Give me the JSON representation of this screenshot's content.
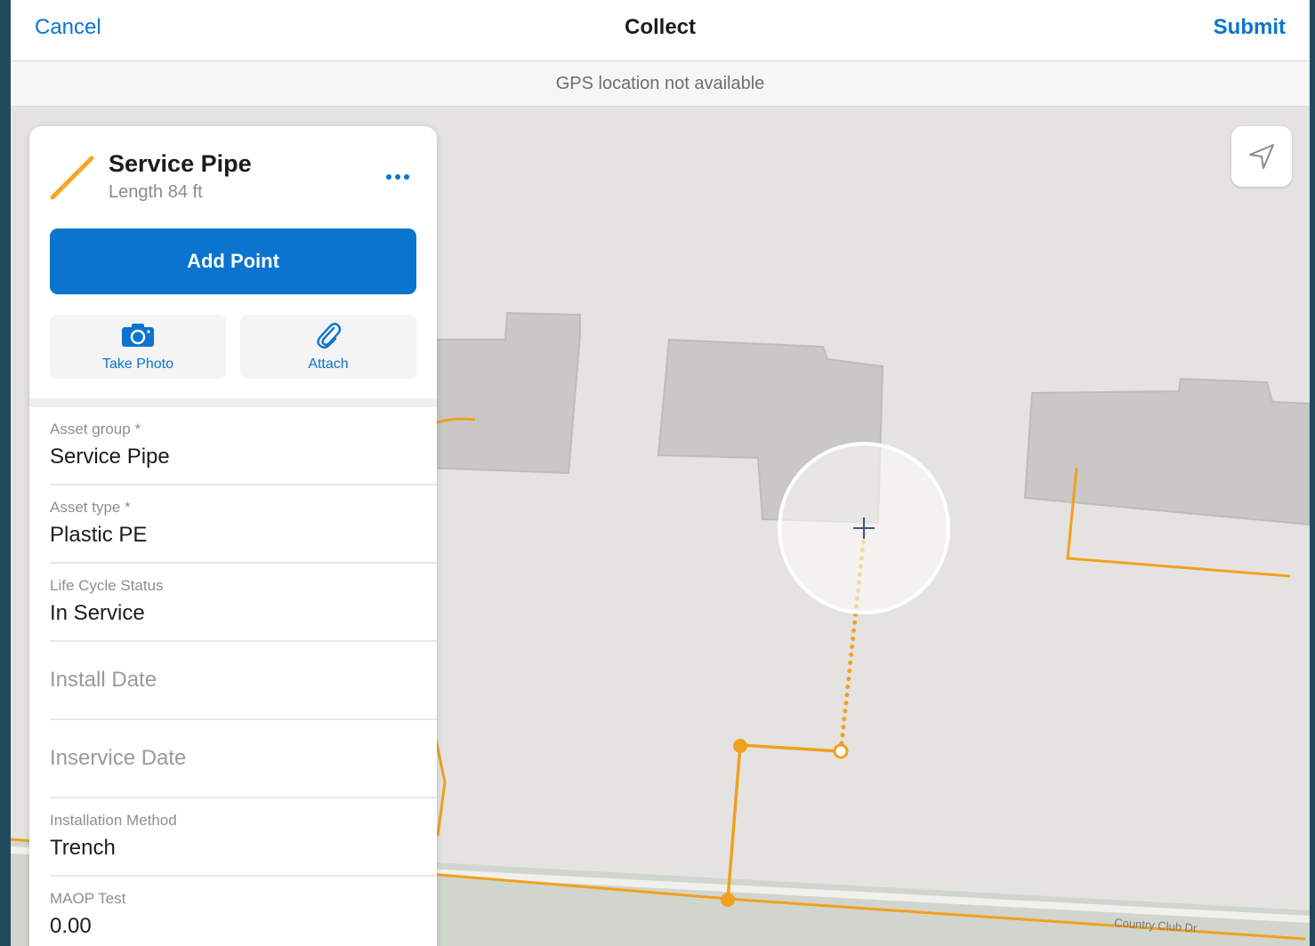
{
  "navbar": {
    "cancel_label": "Cancel",
    "title": "Collect",
    "submit_label": "Submit"
  },
  "gps_status": "GPS location not available",
  "map": {
    "street_label": "Country Club Dr",
    "locate_icon": "navigation-arrow-icon",
    "pipe_color": "#f2a01d"
  },
  "feature": {
    "title": "Service Pipe",
    "subtitle": "Length 84 ft",
    "icon": "line-feature-icon",
    "more_icon": "ellipsis-icon",
    "add_point_label": "Add Point",
    "take_photo_label": "Take Photo",
    "attach_label": "Attach",
    "photo_icon": "camera-icon",
    "attach_icon": "paperclip-icon"
  },
  "fields": [
    {
      "label": "Asset group *",
      "value": "Service Pipe"
    },
    {
      "label": "Asset type *",
      "value": "Plastic PE"
    },
    {
      "label": "Life Cycle Status",
      "value": "In Service"
    },
    {
      "placeholder": "Install Date"
    },
    {
      "placeholder": "Inservice Date"
    },
    {
      "label": "Installation Method",
      "value": "Trench"
    },
    {
      "label": "MAOP Test",
      "value": "0.00"
    }
  ],
  "colors": {
    "accent": "#0a74cf",
    "pipe": "#f2a01d"
  }
}
